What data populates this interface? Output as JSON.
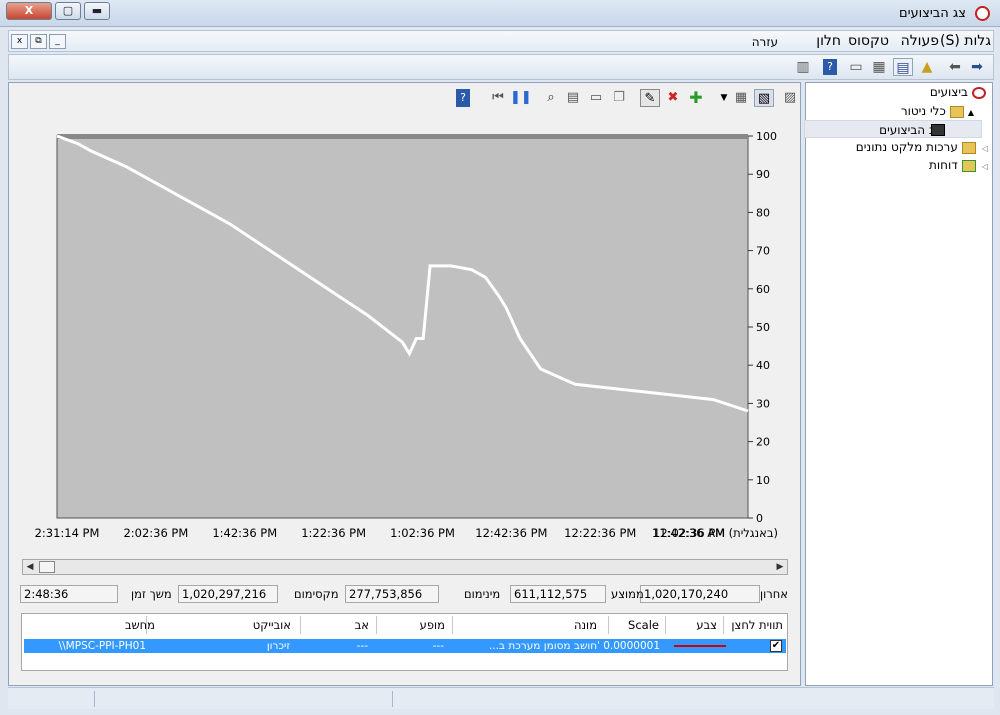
{
  "window": {
    "title": "צג הביצועים"
  },
  "window_controls": {
    "close": "X",
    "maximize": "▢",
    "minimize": "▬"
  },
  "menu": {
    "items": [
      "(S) גלות",
      "פעולה",
      "טקסוס",
      "חלון",
      "עזרה"
    ]
  },
  "mdi_controls": {
    "minimize": "_",
    "restore": "⧉",
    "close": "x"
  },
  "tree": {
    "items": [
      {
        "label": "ביצועים"
      },
      {
        "label": "כלי ניטור"
      },
      {
        "label": "צג הביצועים"
      },
      {
        "label": "ערכות מלקט נתונים"
      },
      {
        "label": "דוחות"
      }
    ]
  },
  "chart_data": {
    "type": "line",
    "title": "",
    "ylim": [
      0,
      100
    ],
    "y_ticks": [
      "100",
      "90",
      "80",
      "70",
      "60",
      "50",
      "40",
      "30",
      "20",
      "10",
      "0"
    ],
    "x_tick_labels": [
      "11:42:36 AM (באנגלית)",
      "12:02:36 PM",
      "12:22:36 PM",
      "12:42:36 PM",
      "1:02:36 PM",
      "1:22:36 PM",
      "1:42:36 PM",
      "2:02:36 PM",
      "2:31:14 PM"
    ],
    "series": [
      {
        "x": [
          0,
          3,
          5,
          10,
          15,
          20,
          25,
          30,
          35,
          40,
          45,
          50,
          51,
          52,
          53,
          54,
          55,
          57,
          60,
          62,
          64,
          65,
          67,
          70,
          75,
          80,
          85,
          90,
          95,
          100
        ],
        "values": [
          100,
          98,
          96,
          92,
          87,
          82,
          77,
          71,
          65,
          59,
          53,
          46,
          43,
          47,
          47,
          66,
          66,
          66,
          65,
          63,
          58,
          55,
          47,
          39,
          35,
          34,
          33,
          32,
          31,
          28
        ]
      }
    ],
    "grid": false,
    "background": "#c0c0c0",
    "line_color": "#ffffff"
  },
  "stats": {
    "last_label": "אחרון",
    "last_value": "1,020,170,240",
    "avg_label": "ממוצע",
    "avg_value": "611,112,575",
    "min_label": "מינימום",
    "min_value": "277,753,856",
    "max_label": "מקסימום",
    "max_value": "1,020,297,216",
    "dur_label": "משך זמן",
    "dur_value": "2:48:36"
  },
  "table": {
    "headers": [
      "תווית לחצן",
      "צבע",
      "Scale",
      "מונה",
      "מופע",
      "אב",
      "אובייקט",
      "מחשב"
    ],
    "row": {
      "scale": "0.0000001",
      "counter": "...חושב מסומן מערכת ב'",
      "instance": "---",
      "parent": "---",
      "object": "זיכרון",
      "computer": "\\\\MPSC-PPI-PH01"
    }
  },
  "colors": {
    "accent": "#3399ff",
    "series_line": "#cc0000"
  }
}
